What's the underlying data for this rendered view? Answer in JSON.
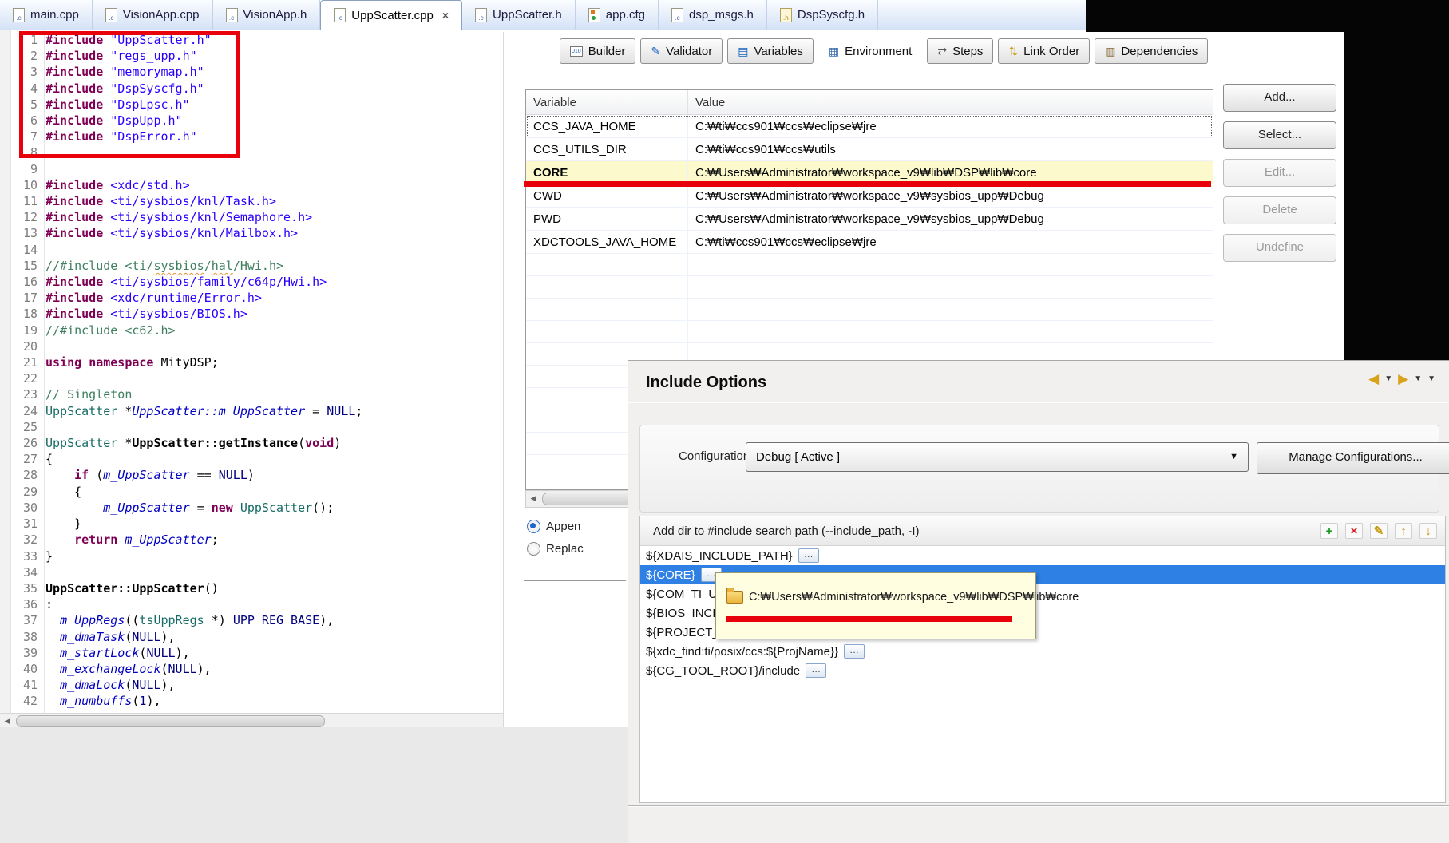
{
  "ui": {
    "close_glyph": "×",
    "left_arrow": "◀",
    "caret": "▼",
    "more_glyph": "…"
  },
  "colors": {
    "annotation_red": "#e8000a",
    "selection_blue": "#2e80e4",
    "highlight_yellow": "#fcfacd",
    "tooltip_bg": "#fffee1"
  },
  "editor": {
    "tabs": [
      {
        "label": "main.cpp",
        "icon": "c",
        "icon_text": ".c"
      },
      {
        "label": "VisionApp.cpp",
        "icon": "c",
        "icon_text": ".c"
      },
      {
        "label": "VisionApp.h",
        "icon": "c",
        "icon_text": ".c"
      },
      {
        "label": "UppScatter.cpp",
        "icon": "c",
        "icon_text": ".c",
        "active": true
      },
      {
        "label": "UppScatter.h",
        "icon": "c",
        "icon_text": ".c"
      },
      {
        "label": "app.cfg",
        "icon": "cfg",
        "icon_text": ""
      },
      {
        "label": "dsp_msgs.h",
        "icon": "c",
        "icon_text": ".c"
      },
      {
        "label": "DspSyscfg.h",
        "icon": "h",
        "icon_text": ".h"
      }
    ],
    "code_lines": [
      [
        [
          "#include ",
          "k"
        ],
        [
          "\"UppScatter.h\"",
          "s"
        ]
      ],
      [
        [
          "#include ",
          "k"
        ],
        [
          "\"regs_upp.h\"",
          "s"
        ]
      ],
      [
        [
          "#include ",
          "k"
        ],
        [
          "\"memorymap.h\"",
          "s"
        ]
      ],
      [
        [
          "#include ",
          "k"
        ],
        [
          "\"DspSyscfg.h\"",
          "s"
        ]
      ],
      [
        [
          "#include ",
          "k"
        ],
        [
          "\"DspLpsc.h\"",
          "s"
        ]
      ],
      [
        [
          "#include ",
          "k"
        ],
        [
          "\"DspUpp.h\"",
          "s"
        ]
      ],
      [
        [
          "#include ",
          "k"
        ],
        [
          "\"DspError.h\"",
          "s"
        ]
      ],
      [],
      [],
      [
        [
          "#include ",
          "k"
        ],
        [
          "<xdc/std.h>",
          "s"
        ]
      ],
      [
        [
          "#include ",
          "k"
        ],
        [
          "<ti/sysbios/knl/Task.h>",
          "s"
        ]
      ],
      [
        [
          "#include ",
          "k"
        ],
        [
          "<ti/sysbios/knl/Semaphore.h>",
          "s"
        ]
      ],
      [
        [
          "#include ",
          "k"
        ],
        [
          "<ti/sysbios/knl/Mailbox.h>",
          "s"
        ]
      ],
      [],
      [
        [
          "//#include <ti/",
          "c"
        ],
        [
          "sysbios",
          "q"
        ],
        [
          "/",
          "c"
        ],
        [
          "hal",
          "q"
        ],
        [
          "/Hwi.h>",
          "c"
        ]
      ],
      [
        [
          "#include ",
          "k"
        ],
        [
          "<ti/sysbios/family/c64p/Hwi.h>",
          "s"
        ]
      ],
      [
        [
          "#include ",
          "k"
        ],
        [
          "<xdc/runtime/Error.h>",
          "s"
        ]
      ],
      [
        [
          "#include ",
          "k"
        ],
        [
          "<ti/sysbios/BIOS.h>",
          "s"
        ]
      ],
      [
        [
          "//#include <c62.h>",
          "c"
        ]
      ],
      [],
      [
        [
          "using",
          "k"
        ],
        [
          " ",
          "p"
        ],
        [
          "namespace",
          "k"
        ],
        [
          " MityDSP;",
          "p"
        ]
      ],
      [],
      [
        [
          "// Singleton",
          "c"
        ]
      ],
      [
        [
          "UppScatter",
          "t"
        ],
        [
          " *",
          "p"
        ],
        [
          "UppScatter::m_UppScatter",
          "m"
        ],
        [
          " = ",
          "p"
        ],
        [
          "NULL",
          "x"
        ],
        [
          ";",
          "p"
        ]
      ],
      [],
      [
        [
          "UppScatter",
          "t"
        ],
        [
          " *",
          "p"
        ],
        [
          "UppScatter::getInstance",
          "f"
        ],
        [
          "(",
          "p"
        ],
        [
          "void",
          "k"
        ],
        [
          ")",
          "p"
        ]
      ],
      [
        [
          "{",
          "p"
        ]
      ],
      [
        [
          "    ",
          "p"
        ],
        [
          "if",
          "k"
        ],
        [
          " (",
          "p"
        ],
        [
          "m_UppScatter",
          "m"
        ],
        [
          " == ",
          "p"
        ],
        [
          "NULL",
          "x"
        ],
        [
          ")",
          "p"
        ]
      ],
      [
        [
          "    {",
          "p"
        ]
      ],
      [
        [
          "        ",
          "p"
        ],
        [
          "m_UppScatter",
          "m"
        ],
        [
          " = ",
          "p"
        ],
        [
          "new",
          "k"
        ],
        [
          " ",
          "p"
        ],
        [
          "UppScatter",
          "t"
        ],
        [
          "();",
          "p"
        ]
      ],
      [
        [
          "    }",
          "p"
        ]
      ],
      [
        [
          "    ",
          "p"
        ],
        [
          "return",
          "k"
        ],
        [
          " ",
          "p"
        ],
        [
          "m_UppScatter",
          "m"
        ],
        [
          ";",
          "p"
        ]
      ],
      [
        [
          "}",
          "p"
        ]
      ],
      [],
      [
        [
          "UppScatter::UppScatter",
          "f"
        ],
        [
          "()",
          "p"
        ]
      ],
      [
        [
          ":",
          "p"
        ]
      ],
      [
        [
          "  ",
          "p"
        ],
        [
          "m_UppRegs",
          "m"
        ],
        [
          "((",
          "p"
        ],
        [
          "tsUppRegs",
          "t"
        ],
        [
          " *) ",
          "p"
        ],
        [
          "UPP_REG_BASE",
          "x"
        ],
        [
          "),",
          "p"
        ]
      ],
      [
        [
          "  ",
          "p"
        ],
        [
          "m_dmaTask",
          "m"
        ],
        [
          "(",
          "p"
        ],
        [
          "NULL",
          "x"
        ],
        [
          "),",
          "p"
        ]
      ],
      [
        [
          "  ",
          "p"
        ],
        [
          "m_startLock",
          "m"
        ],
        [
          "(",
          "p"
        ],
        [
          "NULL",
          "x"
        ],
        [
          "),",
          "p"
        ]
      ],
      [
        [
          "  ",
          "p"
        ],
        [
          "m_exchangeLock",
          "m"
        ],
        [
          "(",
          "p"
        ],
        [
          "NULL",
          "x"
        ],
        [
          "),",
          "p"
        ]
      ],
      [
        [
          "  ",
          "p"
        ],
        [
          "m_dmaLock",
          "m"
        ],
        [
          "(",
          "p"
        ],
        [
          "NULL",
          "x"
        ],
        [
          "),",
          "p"
        ]
      ],
      [
        [
          "  ",
          "p"
        ],
        [
          "m_numbuffs",
          "m"
        ],
        [
          "(",
          "p"
        ],
        [
          "1",
          "n"
        ],
        [
          "),",
          "p"
        ]
      ]
    ]
  },
  "properties": {
    "tabs": [
      {
        "label": "Builder",
        "glyph": "010",
        "glyph_color": "#1560bd"
      },
      {
        "label": "Validator",
        "glyph": "✎",
        "glyph_color": "#1560bd"
      },
      {
        "label": "Variables",
        "glyph": "▤",
        "glyph_color": "#1560bd"
      },
      {
        "label": "Environment",
        "glyph": "▦",
        "glyph_color": "#3a6fb0",
        "active": true
      },
      {
        "label": "Steps",
        "glyph": "⇄",
        "glyph_color": "#555555"
      },
      {
        "label": "Link Order",
        "glyph": "⇅",
        "glyph_color": "#c79a10"
      },
      {
        "label": "Dependencies",
        "glyph": "▥",
        "glyph_color": "#8a6d3b"
      }
    ],
    "table": {
      "columns": [
        "Variable",
        "Value"
      ],
      "rows": [
        {
          "variable": "CCS_JAVA_HOME",
          "value": "C:₩ti₩ccs901₩ccs₩eclipse₩jre",
          "focused": true
        },
        {
          "variable": "CCS_UTILS_DIR",
          "value": "C:₩ti₩ccs901₩ccs₩utils"
        },
        {
          "variable": "CORE",
          "value": "C:₩Users₩Administrator₩workspace_v9₩lib₩DSP₩lib₩core",
          "highlighted": true
        },
        {
          "variable": "CWD",
          "value": "C:₩Users₩Administrator₩workspace_v9₩sysbios_upp₩Debug"
        },
        {
          "variable": "PWD",
          "value": "C:₩Users₩Administrator₩workspace_v9₩sysbios_upp₩Debug"
        },
        {
          "variable": "XDCTOOLS_JAVA_HOME",
          "value": "C:₩ti₩ccs901₩ccs₩eclipse₩jre"
        }
      ]
    },
    "buttons": [
      {
        "label": "Add...",
        "enabled": true
      },
      {
        "label": "Select...",
        "enabled": true
      },
      {
        "label": "Edit...",
        "enabled": false
      },
      {
        "label": "Delete",
        "enabled": false
      },
      {
        "label": "Undefine",
        "enabled": false
      }
    ],
    "radios": [
      {
        "label": "Appen",
        "selected": true
      },
      {
        "label": "Replac",
        "selected": false
      }
    ]
  },
  "dialog": {
    "title": "Include Options",
    "nav_icons": [
      {
        "name": "back",
        "glyph": "◀",
        "color": "#d9a21b"
      },
      {
        "name": "back-menu",
        "glyph": "▼",
        "color": "#333333"
      },
      {
        "name": "forward",
        "glyph": "▶",
        "color": "#d9a21b"
      },
      {
        "name": "forward-menu",
        "glyph": "▼",
        "color": "#333333"
      },
      {
        "name": "view-menu",
        "glyph": "▼",
        "color": "#333333"
      }
    ],
    "config_label": "Configuration:",
    "config_value": "Debug  [ Active ]",
    "manage_button": "Manage Configurations...",
    "include_section": {
      "header": "Add dir to #include search path (--include_path, -I)",
      "toolbar_icons": [
        {
          "name": "add",
          "glyph": "+",
          "color": "#189a18"
        },
        {
          "name": "delete",
          "glyph": "×",
          "color": "#d42020"
        },
        {
          "name": "edit",
          "glyph": "✎",
          "color": "#c79a10"
        },
        {
          "name": "move-up",
          "glyph": "↑",
          "color": "#c79a10"
        },
        {
          "name": "move-down",
          "glyph": "↓",
          "color": "#c79a10"
        }
      ],
      "items": [
        {
          "label": "${XDAIS_INCLUDE_PATH}",
          "more": true
        },
        {
          "label": "${CORE}",
          "more": true,
          "selected": true
        },
        {
          "label": "${COM_TI_U",
          "more": false
        },
        {
          "label": "${BIOS_INCL",
          "more": false
        },
        {
          "label": "${PROJECT_ROOT}",
          "more": true
        },
        {
          "label": "${xdc_find:ti/posix/ccs:${ProjName}}",
          "more": true
        },
        {
          "label": "${CG_TOOL_ROOT}/include",
          "more": true
        }
      ]
    },
    "tooltip": {
      "path": "C:₩Users₩Administrator₩workspace_v9₩lib₩DSP₩lib₩core"
    }
  }
}
